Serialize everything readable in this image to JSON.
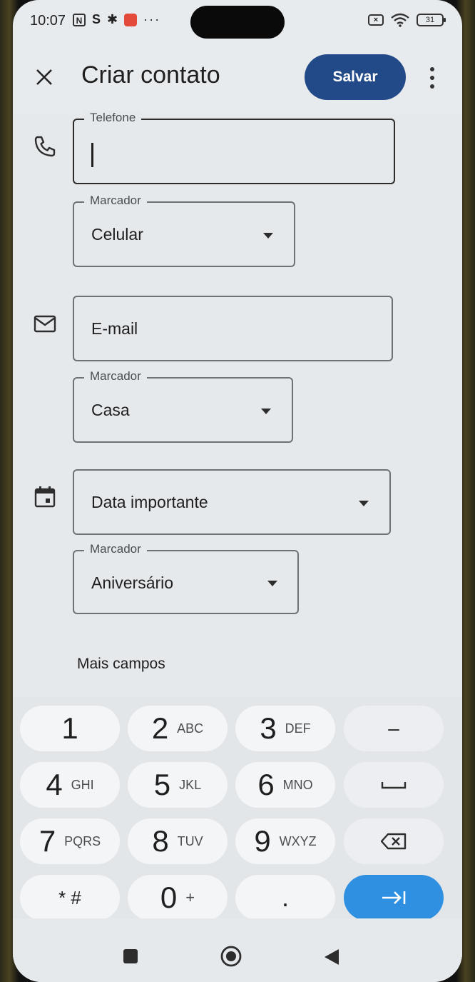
{
  "status_bar": {
    "time": "10:07",
    "battery": "31"
  },
  "header": {
    "title": "Criar contato",
    "save_label": "Salvar"
  },
  "form": {
    "phone": {
      "label": "Telefone",
      "value": ""
    },
    "phone_marker": {
      "label": "Marcador",
      "value": "Celular"
    },
    "email": {
      "placeholder": "E-mail"
    },
    "email_marker": {
      "label": "Marcador",
      "value": "Casa"
    },
    "date": {
      "placeholder": "Data importante"
    },
    "date_marker": {
      "label": "Marcador",
      "value": "Aniversário"
    },
    "more_fields_label": "Mais campos"
  },
  "keyboard": {
    "rows": [
      [
        {
          "num": "1",
          "letters": ""
        },
        {
          "num": "2",
          "letters": "ABC"
        },
        {
          "num": "3",
          "letters": "DEF"
        },
        {
          "num": "–",
          "letters": ""
        }
      ],
      [
        {
          "num": "4",
          "letters": "GHI"
        },
        {
          "num": "5",
          "letters": "JKL"
        },
        {
          "num": "6",
          "letters": "MNO"
        },
        {
          "num": "␣",
          "letters": ""
        }
      ],
      [
        {
          "num": "7",
          "letters": "PQRS"
        },
        {
          "num": "8",
          "letters": "TUV"
        },
        {
          "num": "9",
          "letters": "WXYZ"
        },
        {
          "num": "⌫",
          "letters": ""
        }
      ],
      [
        {
          "num": "* #",
          "letters": ""
        },
        {
          "num": "0",
          "letters": "+"
        },
        {
          "num": ".",
          "letters": ""
        },
        {
          "num": "→|",
          "letters": ""
        }
      ]
    ]
  },
  "colors": {
    "save_button": "#234a88",
    "enter_key": "#2f8fe0",
    "background": "#e6e9ec"
  }
}
